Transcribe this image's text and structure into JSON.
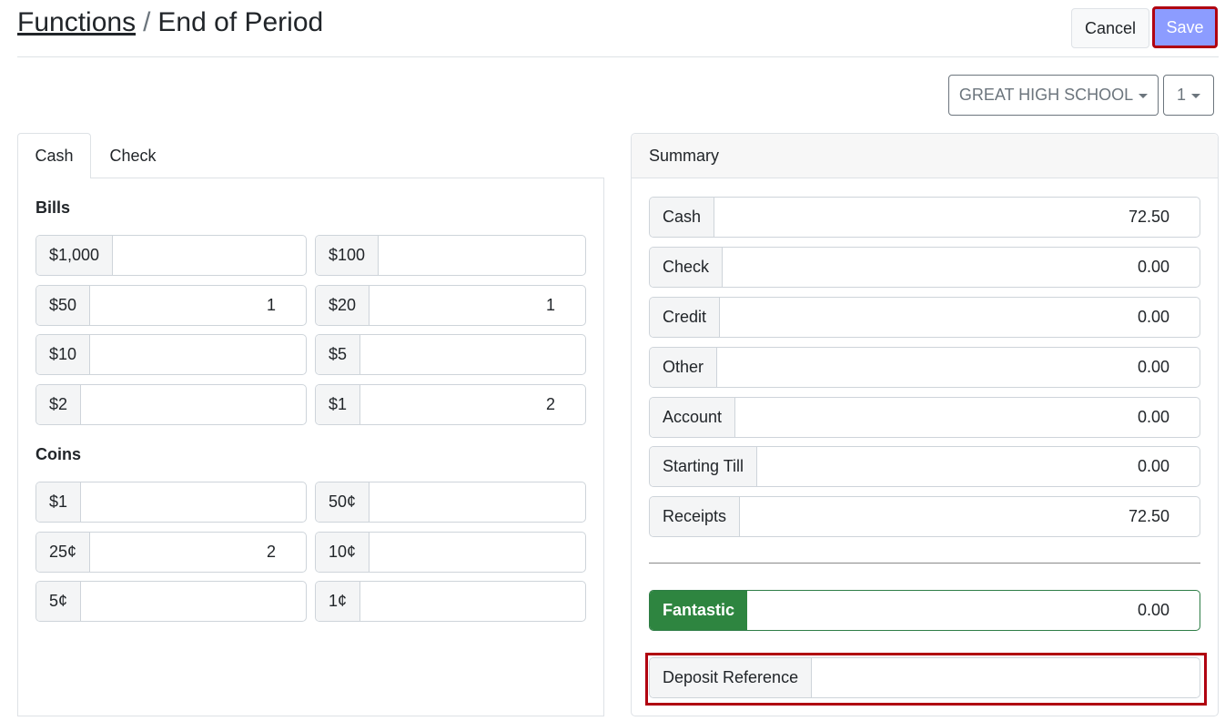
{
  "header": {
    "breadcrumb_link": "Functions",
    "breadcrumb_sep": "/",
    "page_title": "End of Period",
    "cancel_label": "Cancel",
    "save_label": "Save"
  },
  "filters": {
    "school": "GREAT HIGH SCHOOL",
    "period": "1"
  },
  "tabs": [
    {
      "label": "Cash",
      "active": true
    },
    {
      "label": "Check",
      "active": false
    }
  ],
  "bills": {
    "label": "Bills",
    "items": [
      {
        "label": "$1,000",
        "value": ""
      },
      {
        "label": "$100",
        "value": ""
      },
      {
        "label": "$50",
        "value": "1"
      },
      {
        "label": "$20",
        "value": "1"
      },
      {
        "label": "$10",
        "value": ""
      },
      {
        "label": "$5",
        "value": ""
      },
      {
        "label": "$2",
        "value": ""
      },
      {
        "label": "$1",
        "value": "2"
      }
    ]
  },
  "coins": {
    "label": "Coins",
    "items": [
      {
        "label": "$1",
        "value": ""
      },
      {
        "label": "50¢",
        "value": ""
      },
      {
        "label": "25¢",
        "value": "2"
      },
      {
        "label": "10¢",
        "value": ""
      },
      {
        "label": "5¢",
        "value": ""
      },
      {
        "label": "1¢",
        "value": ""
      }
    ]
  },
  "summary": {
    "title": "Summary",
    "rows": [
      {
        "label": "Cash",
        "value": "72.50"
      },
      {
        "label": "Check",
        "value": "0.00"
      },
      {
        "label": "Credit",
        "value": "0.00"
      },
      {
        "label": "Other",
        "value": "0.00"
      },
      {
        "label": "Account",
        "value": "0.00"
      },
      {
        "label": "Starting Till",
        "value": "0.00"
      },
      {
        "label": "Receipts",
        "value": "72.50"
      }
    ],
    "result": {
      "label": "Fantastic",
      "value": "0.00"
    },
    "deposit_reference": {
      "label": "Deposit Reference",
      "value": ""
    }
  },
  "colors": {
    "save_bg": "#8c9cff",
    "highlight_border": "#b00010",
    "fantastic_green": "#2e8540"
  }
}
